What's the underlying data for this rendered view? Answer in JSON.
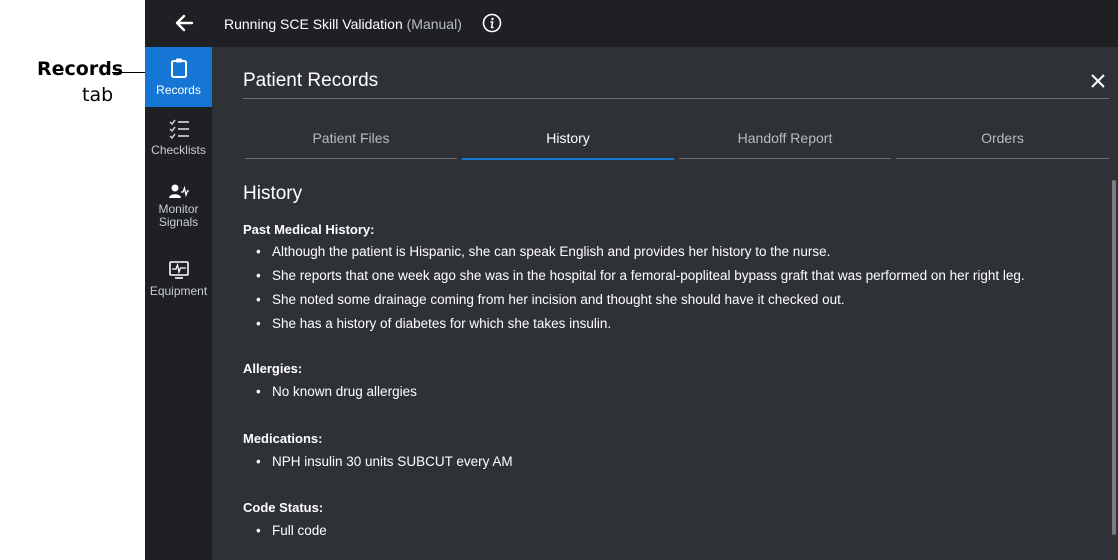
{
  "callout": {
    "title": "Records",
    "subtitle": "tab"
  },
  "topbar": {
    "title_main": "Running SCE  Skill Validation",
    "title_mode": " (Manual)",
    "back_icon": "back-arrow-icon",
    "info_icon": "info-icon"
  },
  "sidebar": {
    "items": [
      {
        "label": "Records",
        "icon": "clipboard-icon",
        "active": true
      },
      {
        "label": "Checklists",
        "icon": "checklist-icon",
        "active": false
      },
      {
        "label": "Monitor Signals",
        "line1": "Monitor",
        "line2": "Signals",
        "icon": "monitor-signals-icon",
        "active": false
      },
      {
        "label": "Equipment",
        "icon": "equipment-icon",
        "active": false
      }
    ]
  },
  "panel": {
    "title": "Patient Records",
    "close_icon": "close-icon"
  },
  "tabs": [
    {
      "label": "Patient Files",
      "active": false
    },
    {
      "label": "History",
      "active": true
    },
    {
      "label": "Handoff Report",
      "active": false
    },
    {
      "label": "Orders",
      "active": false
    }
  ],
  "history": {
    "title": "History",
    "sections": [
      {
        "header": "Past Medical History:",
        "items": [
          "Although the patient is Hispanic, she can speak English and provides her history to the nurse.",
          "She reports that one week ago she was in the hospital for a femoral-popliteal bypass graft that was performed on her right leg.",
          "She noted some drainage coming from her incision and thought she should have it checked out.",
          "She has a history of diabetes for which she takes insulin."
        ]
      },
      {
        "header": "Allergies:",
        "items": [
          "No known drug allergies"
        ]
      },
      {
        "header": "Medications:",
        "items": [
          "NPH insulin 30 units SUBCUT every AM"
        ]
      },
      {
        "header": "Code Status:",
        "items": [
          "Full code"
        ]
      }
    ]
  },
  "colors": {
    "accent": "#1676d6",
    "sidebar_bg": "#1e2024",
    "panel_bg": "#2e3136"
  }
}
